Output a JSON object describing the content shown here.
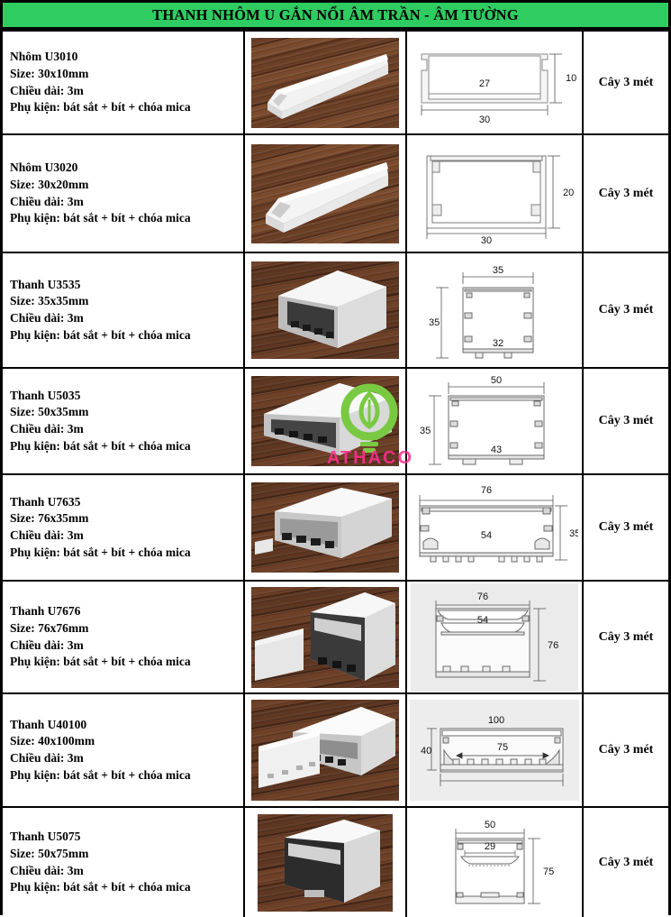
{
  "header": {
    "title": "THANH NHÔM U GẮN NỔI ÂM TRẦN - ÂM TƯỜNG",
    "bg_color": "#2ECC61"
  },
  "watermark": {
    "brand": "ATHACO",
    "icon": "lightbulb-leaf-icon",
    "bulb_color": "#7AC943",
    "text_color": "#ff2f8f"
  },
  "labels": {
    "size_prefix": "Size:",
    "length_prefix": "Chiều dài:",
    "accessories_prefix": "Phụ kiện:"
  },
  "rows": [
    {
      "name": "Nhôm U3010",
      "size": "Size: 30x10mm",
      "length": "Chiều dài: 3m",
      "accessories": "Phụ kiện: bát sắt + bít + chóa mica",
      "unit": "Cây 3 mét",
      "photo_alt": "u3010-profile-photo",
      "drawing": {
        "width": "30",
        "height": "10",
        "inner": "27",
        "style": "flat-cover"
      }
    },
    {
      "name": "Nhôm U3020",
      "size": "Size: 30x20mm",
      "length": "Chiều dài: 3m",
      "accessories": "Phụ kiện: bát sắt + bít + chóa mica",
      "unit": "Cây 3 mét",
      "photo_alt": "u3020-profile-photo",
      "drawing": {
        "width": "30",
        "height": "20",
        "inner": "",
        "style": "deep-box"
      }
    },
    {
      "name": "Thanh U3535",
      "size": "Size: 35x35mm",
      "length": "Chiều dài: 3m",
      "accessories": "Phụ kiện: bát sắt + bít + chóa mica",
      "unit": "Cây 3 mét",
      "photo_alt": "u3535-profile-photo",
      "drawing": {
        "width": "35",
        "height": "35",
        "inner": "32",
        "style": "square-box"
      }
    },
    {
      "name": "Thanh U5035",
      "size": "Size: 50x35mm",
      "length": "Chiều dài: 3m",
      "accessories": "Phụ kiện: bát sắt + bít + chóa mica",
      "unit": "Cây 3 mét",
      "photo_alt": "u5035-profile-photo",
      "drawing": {
        "width": "50",
        "height": "35",
        "inner": "43",
        "style": "square-box"
      }
    },
    {
      "name": "Thanh U7635",
      "size": "Size: 76x35mm",
      "length": "Chiều dài: 3m",
      "accessories": "Phụ kiện: bát sắt + bít + chóa mica",
      "unit": "Cây 3 mét",
      "photo_alt": "u7635-profile-photo",
      "drawing": {
        "width": "76",
        "height": "35",
        "inner": "54",
        "style": "wide-box"
      }
    },
    {
      "name": "Thanh U7676",
      "size": "Size: 76x76mm",
      "length": "Chiều dài: 3m",
      "accessories": "Phụ kiện: bát sắt + bít + chóa mica",
      "unit": "Cây 3 mét",
      "photo_alt": "u7676-profile-photo",
      "drawing": {
        "width": "76",
        "height": "76",
        "inner": "54",
        "style": "tall-box-gray"
      }
    },
    {
      "name": "Thanh U40100",
      "size": "Size: 40x100mm",
      "length": "Chiều dài: 3m",
      "accessories": "Phụ kiện: bát sắt + bít + chóa mica",
      "unit": "Cây 3 mét",
      "photo_alt": "u40100-profile-photo",
      "drawing": {
        "width": "100",
        "height": "40",
        "inner": "75",
        "style": "flat-wide-gray"
      }
    },
    {
      "name": "Thanh U5075",
      "size": "Size: 50x75mm",
      "length": "Chiều dài: 3m",
      "accessories": "Phụ kiện: bát sắt + bít + chóa mica",
      "unit": "Cây 3 mét",
      "photo_alt": "u5075-profile-photo",
      "drawing": {
        "width": "50",
        "height": "75",
        "inner": "29",
        "style": "tall-box"
      }
    }
  ]
}
